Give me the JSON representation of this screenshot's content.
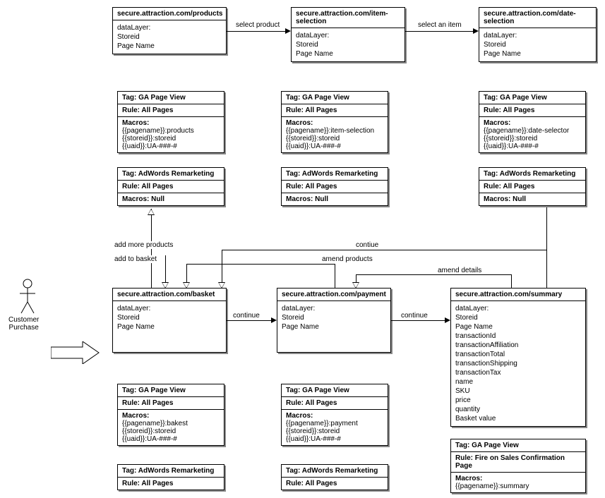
{
  "pages": {
    "products": {
      "url": "secure.attraction.com/products",
      "body": "dataLayer:\nStoreid\nPage Name"
    },
    "item": {
      "url": "secure.attraction.com/item-selection",
      "body": "dataLayer:\nStoreid\nPage Name"
    },
    "date": {
      "url": "secure.attraction.com/date-selection",
      "body": "dataLayer:\nStoreid\nPage Name"
    },
    "basket": {
      "url": "secure.attraction.com/basket",
      "body": "dataLayer:\nStoreid\nPage Name"
    },
    "payment": {
      "url": "secure.attraction.com/payment",
      "body": "dataLayer:\nStoreid\nPage Name"
    },
    "summary": {
      "url": "secure.attraction.com/summary",
      "body": "dataLayer:\nStoreid\nPage Name\ntransactionId\ntransactionAffiliation\ntransactionTotal\ntransactionShipping\ntransactionTax\nname\nSKU\nprice\nquantity\nBasket value"
    }
  },
  "ga": {
    "tag": "Tag: GA Page View",
    "rule": "Rule: All Pages",
    "mlabel": "Macros:",
    "products": "{{pagename}}:products\n{{storeid}}:storeid\n{{uaid}}:UA-###-#",
    "item": "{{pagename}}:item-selection\n{{storeid}}:storeid\n{{uaid}}:UA-###-#",
    "date": "{{pagename}}:date-selector\n{{storeid}}:storeid\n{{uaid}}:UA-###-#",
    "basket": "{{pagename}}:bakest\n{{storeid}}:storeid\n{{uaid}}:UA-###-#",
    "payment": "{{pagename}}:payment\n{{storeid}}:storeid\n{{uaid}}:UA-###-#",
    "summary_rule": "Rule: Fire on Sales Confirmation Page",
    "summary": "{{pagename}}:summary"
  },
  "aw": {
    "tag": "Tag: AdWords Remarketing",
    "rule": "Rule: All Pages",
    "macros": "Macros: Null"
  },
  "edges": {
    "select_product": "select product",
    "select_item": "select an item",
    "add_more": "add more products",
    "add_basket": "add to basket",
    "continue": "continue",
    "contiue": "contiue",
    "amend_products": "amend products",
    "amend_details": "amend details"
  },
  "actor": "Customer\nPurchase"
}
